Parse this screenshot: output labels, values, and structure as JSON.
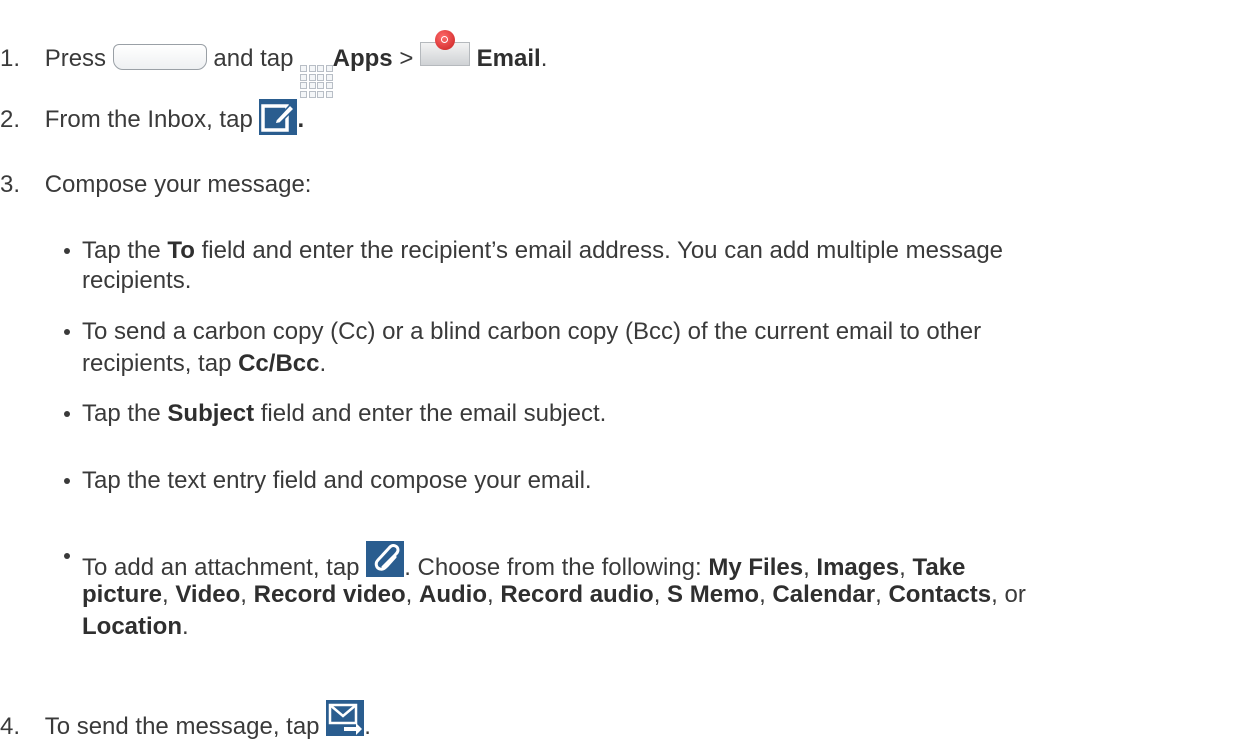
{
  "steps": {
    "s1": {
      "num": "1.",
      "press": "Press",
      "and_tap": "and tap",
      "apps": "Apps",
      "gt": ">",
      "email": "Email",
      "end": "."
    },
    "s2": {
      "num": "2.",
      "text": "From the Inbox, tap",
      "end": "."
    },
    "s3": {
      "num": "3.",
      "text": "Compose your message:"
    },
    "s4": {
      "num": "4.",
      "text": "To send the message, tap",
      "end": "."
    }
  },
  "bullets": {
    "b1": {
      "pre": "Tap the",
      "to": "To",
      "post": "field and enter the recipient’s email address. You can add multiple message",
      "line2": "recipients."
    },
    "b2": {
      "line1": "To send a carbon copy (Cc) or a blind carbon copy (Bcc) of the current email to other",
      "pre": "recipients, tap",
      "ccbcc": "Cc/Bcc",
      "end": "."
    },
    "b3": {
      "pre": "Tap the",
      "subject": "Subject",
      "post": "field and enter the email subject."
    },
    "b4": {
      "text": "Tap the text entry field and compose your email."
    },
    "b5": {
      "pre": "To add an attachment, tap",
      "post": ". Choose from the following:",
      "my_files": "My Files",
      "images": "Images",
      "take": "Take",
      "picture": "picture",
      "video": "Video",
      "record_video": "Record video",
      "audio": "Audio",
      "record_audio": "Record audio",
      "s_memo": "S Memo",
      "calendar": "Calendar",
      "contacts": "Contacts",
      "or": "or",
      "location": "Location",
      "comma": ",",
      "end": "."
    }
  },
  "icons": {
    "home": "home-button-icon",
    "apps": "apps-grid-icon",
    "email": "email-app-icon",
    "compose": "compose-icon",
    "attach": "paperclip-attach-icon",
    "send": "send-icon"
  },
  "colors": {
    "icon_blue": "#2a5d8f",
    "text": "#3a3a3a",
    "email_red": "#c81e1e"
  }
}
